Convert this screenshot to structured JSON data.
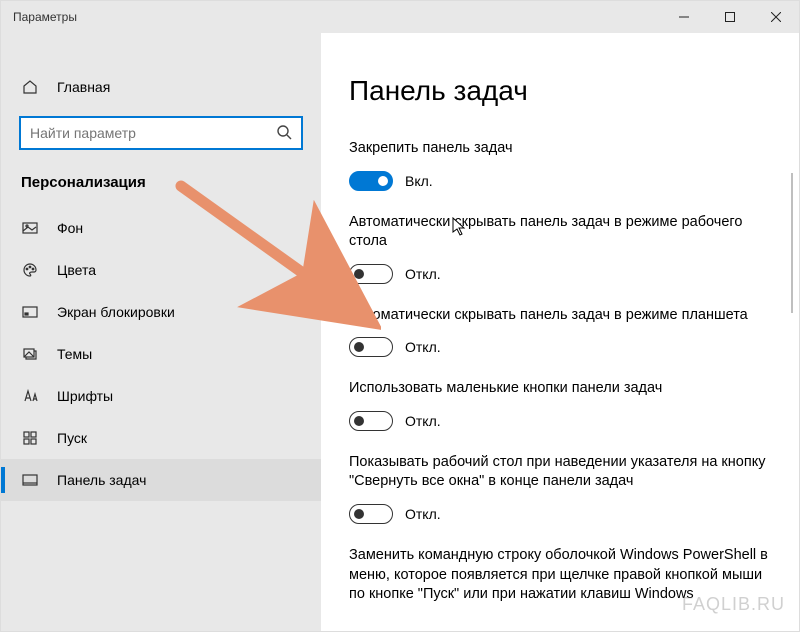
{
  "window": {
    "title": "Параметры"
  },
  "sidebar": {
    "home": "Главная",
    "search_placeholder": "Найти параметр",
    "category": "Персонализация",
    "items": [
      {
        "label": "Фон"
      },
      {
        "label": "Цвета"
      },
      {
        "label": "Экран блокировки"
      },
      {
        "label": "Темы"
      },
      {
        "label": "Шрифты"
      },
      {
        "label": "Пуск"
      },
      {
        "label": "Панель задач"
      }
    ]
  },
  "main": {
    "title": "Панель задач",
    "settings": [
      {
        "label": "Закрепить панель задач",
        "on": true,
        "state": "Вкл."
      },
      {
        "label": "Автоматически скрывать панель задач в режиме рабочего стола",
        "on": false,
        "state": "Откл."
      },
      {
        "label": "Автоматически скрывать панель задач в режиме планшета",
        "on": false,
        "state": "Откл."
      },
      {
        "label": "Использовать маленькие кнопки панели задач",
        "on": false,
        "state": "Откл."
      },
      {
        "label": "Показывать рабочий стол при наведении указателя на кнопку \"Свернуть все окна\" в конце панели задач",
        "on": false,
        "state": "Откл."
      },
      {
        "label": "Заменить командную строку оболочкой Windows PowerShell в меню, которое появляется при щелчке правой кнопкой мыши по кнопке \"Пуск\" или при нажатии клавиш Windows",
        "on": null,
        "state": ""
      }
    ]
  },
  "watermark": "FAQLIB.RU",
  "colors": {
    "accent": "#0078d4",
    "arrow": "#e8916c"
  }
}
